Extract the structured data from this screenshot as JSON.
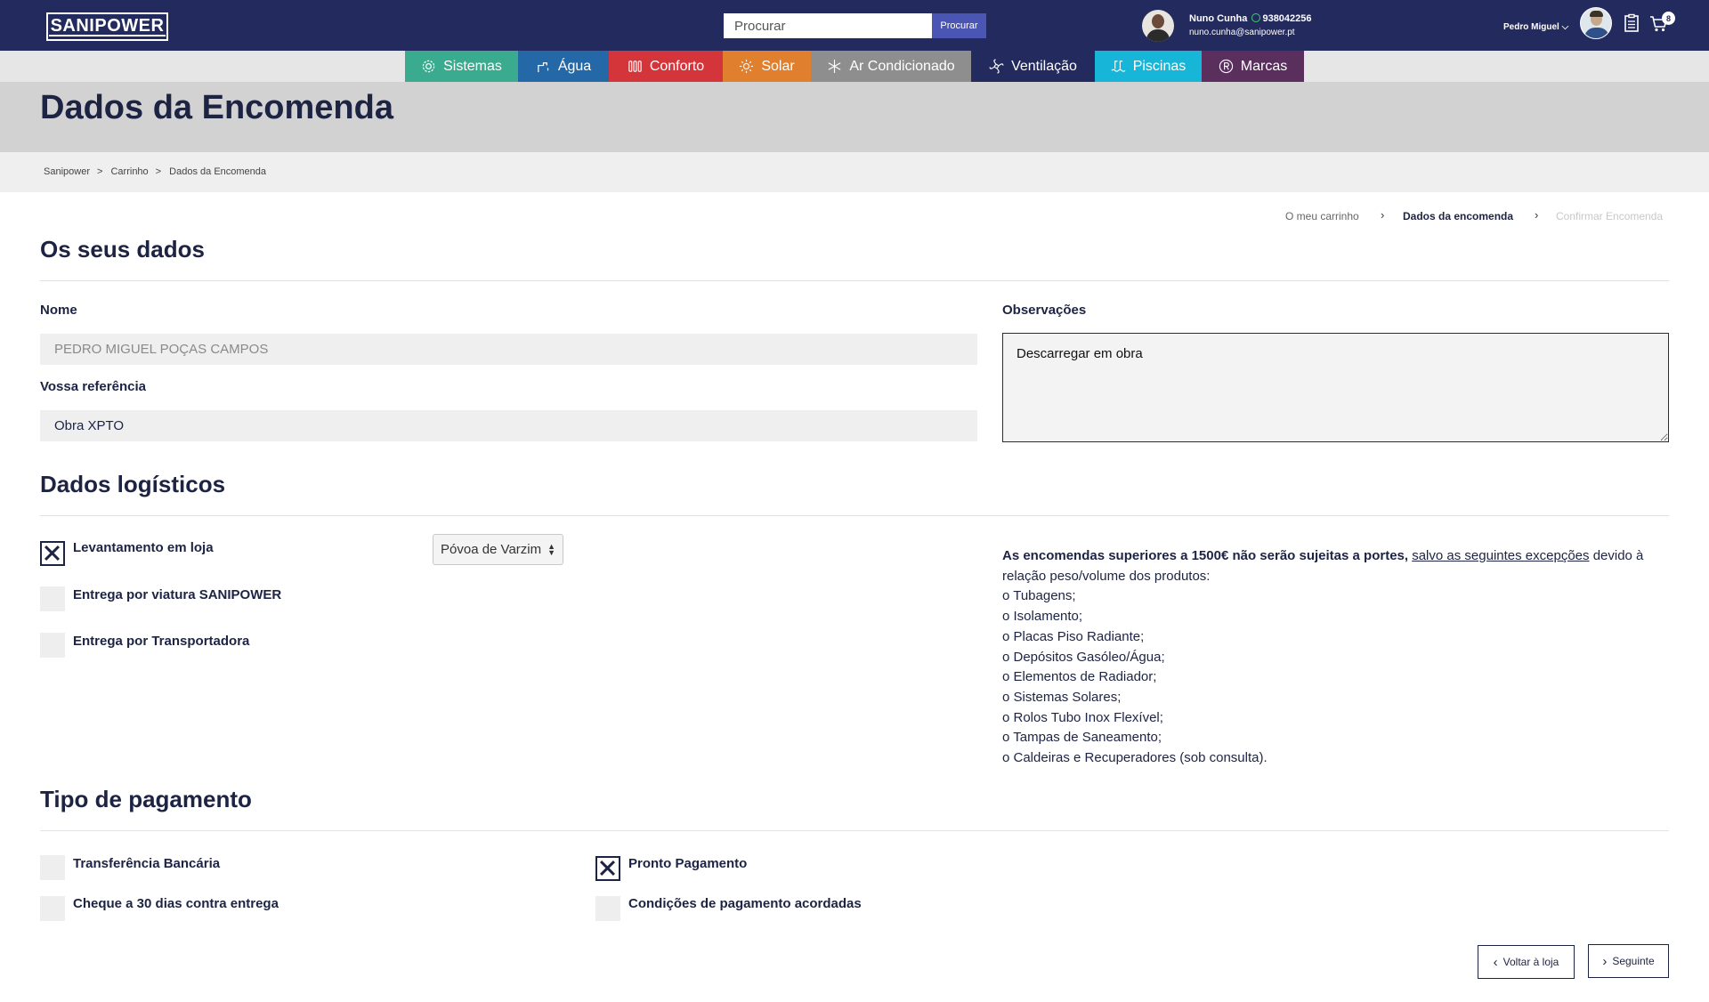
{
  "header": {
    "logo": "SANIPOWER",
    "search": {
      "placeholder": "Procurar",
      "button": "Procurar"
    },
    "contact": {
      "name": "Nuno Cunha",
      "phone": "938042256",
      "email": "nuno.cunha@sanipower.pt"
    },
    "user": {
      "name": "Pedro Miguel"
    },
    "cart_count": "8"
  },
  "nav": [
    {
      "label": "Sistemas",
      "icon": "gear-icon",
      "color": "#3aab8e"
    },
    {
      "label": "Água",
      "icon": "faucet-icon",
      "color": "#2568a7"
    },
    {
      "label": "Conforto",
      "icon": "radiator-icon",
      "color": "#d4353b"
    },
    {
      "label": "Solar",
      "icon": "sun-icon",
      "color": "#e07f2e"
    },
    {
      "label": "Ar Condicionado",
      "icon": "snowflake-icon",
      "color": "#8e8e8e"
    },
    {
      "label": "Ventilação",
      "icon": "fan-icon",
      "color": "#232a5e"
    },
    {
      "label": "Piscinas",
      "icon": "pool-icon",
      "color": "#17b6d8"
    },
    {
      "label": "Marcas",
      "icon": "registered-icon",
      "color": "#5a2f5e"
    }
  ],
  "page": {
    "title": "Dados da Encomenda",
    "breadcrumb": [
      "Sanipower",
      "Carrinho",
      "Dados da Encomenda"
    ],
    "steps": [
      "O meu carrinho",
      "Dados da encomenda",
      "Confirmar Encomenda"
    ]
  },
  "your_data": {
    "heading": "Os seus dados",
    "name_label": "Nome",
    "name_value": "PEDRO MIGUEL POÇAS CAMPOS",
    "reference_label": "Vossa referência",
    "reference_value": "Obra XPTO",
    "observations_label": "Observações",
    "observations_value": "Descarregar em obra"
  },
  "logistics": {
    "heading": "Dados logísticos",
    "options": [
      {
        "label": "Levantamento em loja",
        "checked": true
      },
      {
        "label": "Entrega por viatura SANIPOWER",
        "checked": false
      },
      {
        "label": "Entrega por Transportadora",
        "checked": false
      }
    ],
    "store_selected": "Póvoa de Varzim",
    "info": {
      "intro_bold": "As encomendas superiores a 1500€ não serão sujeitas a portes,",
      "link": "salvo as seguintes excepções",
      "intro_rest": "devido à relação peso/volume dos produtos:",
      "items": [
        "o Tubagens;",
        "o Isolamento;",
        "o Placas Piso Radiante;",
        "o Depósitos Gasóleo/Água;",
        "o Elementos de Radiador;",
        "o Sistemas Solares;",
        "o Rolos Tubo Inox Flexível;",
        "o Tampas de Saneamento;",
        "o Caldeiras e Recuperadores (sob consulta)."
      ]
    }
  },
  "payment": {
    "heading": "Tipo de pagamento",
    "options": [
      {
        "label": "Transferência Bancária",
        "checked": false
      },
      {
        "label": "Cheque a 30 dias contra entrega",
        "checked": false
      },
      {
        "label": "Pronto Pagamento",
        "checked": true
      },
      {
        "label": "Condições de pagamento acordadas",
        "checked": false
      }
    ]
  },
  "actions": {
    "back": "Voltar à loja",
    "next": "Seguinte"
  }
}
